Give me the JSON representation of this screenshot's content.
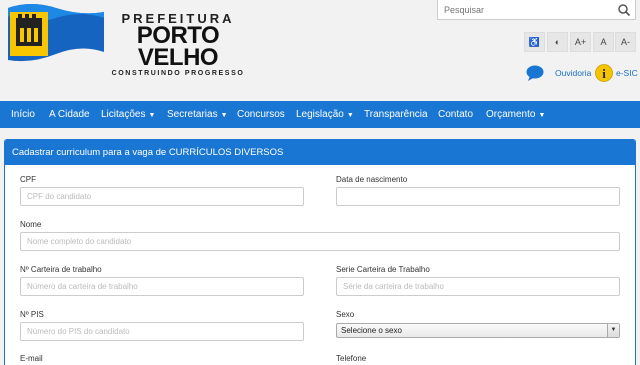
{
  "header": {
    "logo": {
      "line1": "PREFEITURA",
      "line2": "PORTO VELHO",
      "line3": "CONSTRUINDO PROGRESSO"
    },
    "search": {
      "placeholder": "Pesquisar",
      "icon": "search-icon"
    },
    "accessibility": [
      {
        "name": "accessibility-icon",
        "label": "♿"
      },
      {
        "name": "contrast-icon",
        "label": "◐"
      },
      {
        "name": "font-increase",
        "label": "A+"
      },
      {
        "name": "font-reset",
        "label": "A"
      },
      {
        "name": "font-decrease",
        "label": "A-"
      }
    ],
    "ouvidoria_label": "Ouvidoria",
    "esic_label": "e-SIC"
  },
  "nav": [
    {
      "label": "Início",
      "caret": false
    },
    {
      "label": "A Cidade",
      "caret": false
    },
    {
      "label": "Licitações",
      "caret": true
    },
    {
      "label": "Secretarias",
      "caret": true
    },
    {
      "label": "Concursos",
      "caret": false
    },
    {
      "label": "Legislação",
      "caret": true
    },
    {
      "label": "Transparência",
      "caret": false
    },
    {
      "label": "Contato",
      "caret": false
    },
    {
      "label": "Orçamento",
      "caret": true
    }
  ],
  "form": {
    "title": "Cadastrar curriculum para a vaga de CURRÍCULOS DIVERSOS",
    "fields": {
      "cpf": {
        "label": "CPF",
        "placeholder": "CPF do candidato"
      },
      "birth": {
        "label": "Data de nascimento",
        "placeholder": ""
      },
      "name": {
        "label": "Nome",
        "placeholder": "Nome completo do candidato"
      },
      "ctps": {
        "label": "Nº Carteira de trabalho",
        "placeholder": "Número da carteira de trabalho"
      },
      "ctps_series": {
        "label": "Serie Carteira de Trabalho",
        "placeholder": "Série da carteira de trabalho"
      },
      "pis": {
        "label": "Nº PIS",
        "placeholder": "Número do PIS do candidato"
      },
      "sex": {
        "label": "Sexo",
        "selected": "Selecione o sexo"
      },
      "email": {
        "label": "E-mail"
      },
      "phone": {
        "label": "Telefone"
      }
    }
  },
  "colors": {
    "brand_blue": "#1976d2",
    "link_blue": "#1a6fc4"
  }
}
